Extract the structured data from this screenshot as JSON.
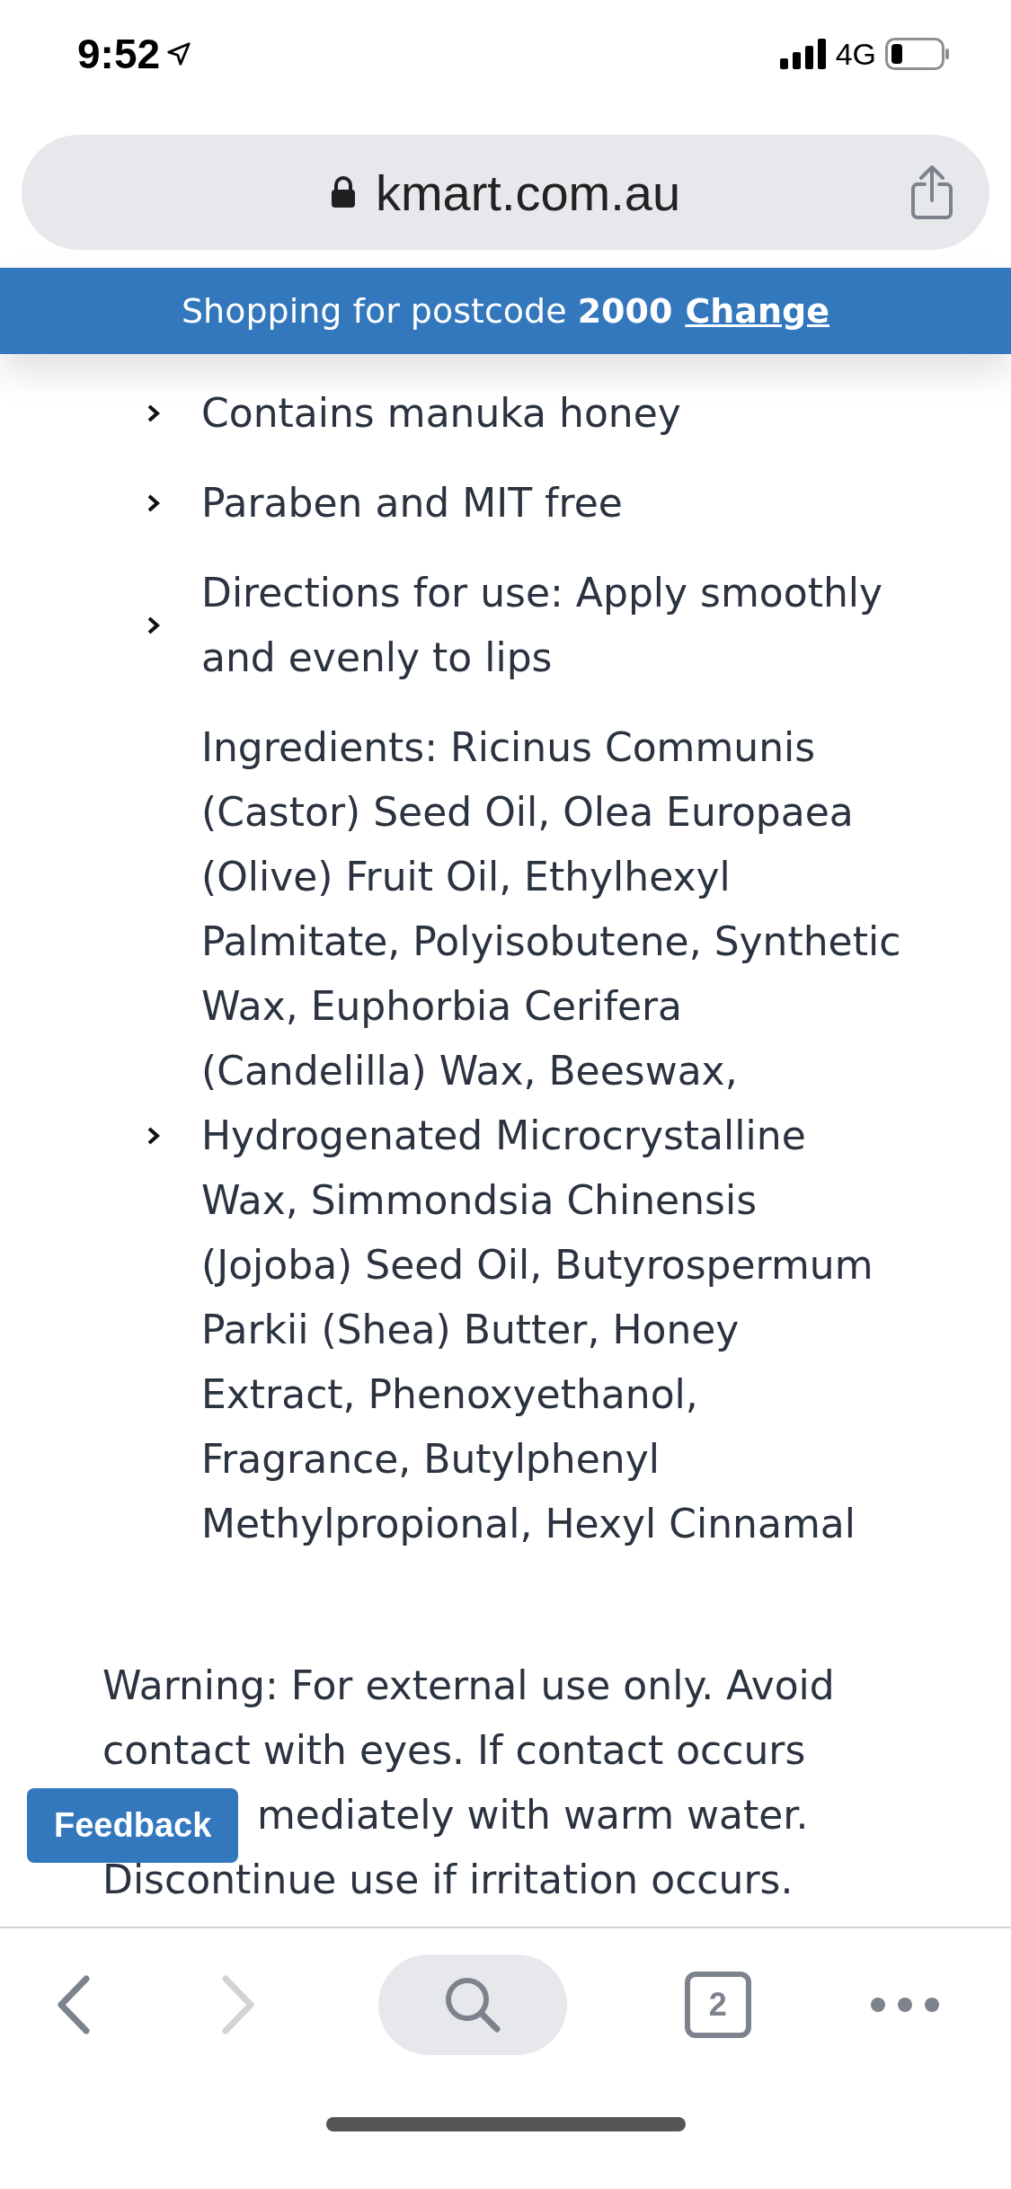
{
  "status_bar": {
    "time": "9:52",
    "network": "4G"
  },
  "address_bar": {
    "url": "kmart.com.au"
  },
  "postcode_banner": {
    "text": "Shopping for postcode",
    "postcode": "2000",
    "link": "Change"
  },
  "bullets": [
    "Contains manuka honey",
    "Paraben and MIT free",
    "Directions for use: Apply smoothly and evenly to lips",
    "Ingredients: Ricinus Communis (Castor) Seed Oil, Olea Europaea (Olive) Fruit Oil, Ethylhexyl Palmitate, Polyisobutene, Synthetic Wax, Euphorbia Cerifera (Candelilla) Wax, Beeswax, Hydrogenated Microcrystalline Wax, Simmondsia Chinensis (Jojoba) Seed Oil, Butyrospermum Parkii (Shea) Butter, Honey Extract, Phenoxyethanol, Fragrance, Butylphenyl Methylpropional, Hexyl Cinnamal"
  ],
  "warning_lines": [
    "Warning: For external use only. Avoid",
    "contact with eyes. If contact occurs",
    "mediately with warm water.",
    "Discontinue use if irritation occurs."
  ],
  "feedback_button": "Feedback",
  "toolbar": {
    "back_disabled": false,
    "forward_disabled": true,
    "tab_count": "2"
  }
}
